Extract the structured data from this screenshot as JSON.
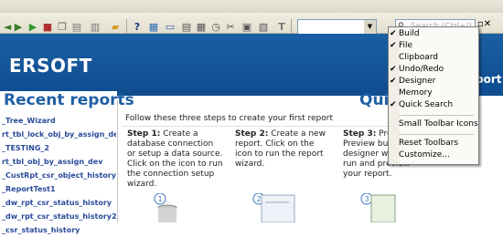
{
  "toolbar": {
    "buttons": [
      "back-icon",
      "forward-icon",
      "run-icon",
      "stop-icon",
      "copy-icon",
      "paste-icon",
      "open-folder-icon",
      "new-folder-icon",
      "help-icon",
      "chart-icon",
      "monitor-icon",
      "table-icon",
      "grid-icon",
      "clock-icon",
      "cut-icon",
      "layout-icon",
      "image-icon",
      "text-icon"
    ],
    "search_placeholder": "Search (Ctrl+I)"
  },
  "header": {
    "brand": "ERSOFT",
    "right_label": "port"
  },
  "left": {
    "title": "Recent reports",
    "items": [
      "_Tree_Wizard",
      "rt_tbl_lock_obj_by_assign_dev",
      "_TESTING_2",
      "rt_tbl_obj_by_assign_dev",
      "_CustRpt_csr_object_history",
      "_ReportTest1",
      "_dw_rpt_csr_status_history",
      "_dw_rpt_csr_status_history2",
      "_csr_status_history"
    ]
  },
  "main": {
    "title": "Quic",
    "intro": "Follow these three steps to create your first report",
    "steps": [
      {
        "label": "Step 1:",
        "text": "Create a database connection or setup a data source. Click on the icon to run the connection setup wizard."
      },
      {
        "label": "Step 2:",
        "text": "Create a new report. Click on the icon to run the report wizard."
      },
      {
        "label": "Step 3:",
        "text": "Pres Preview butt designer win run and preview your report."
      }
    ]
  },
  "menu": {
    "items": [
      {
        "label": "Build",
        "checked": true
      },
      {
        "label": "File",
        "checked": true
      },
      {
        "label": "Clipboard",
        "checked": false
      },
      {
        "label": "Undo/Redo",
        "checked": true
      },
      {
        "label": "Designer",
        "checked": true
      },
      {
        "label": "Memory",
        "checked": false
      },
      {
        "label": "Quick Search",
        "checked": true
      },
      {
        "label": "Small Toolbar Icons",
        "checked": false
      },
      {
        "label": "Reset Toolbars",
        "checked": false
      },
      {
        "label": "Customize...",
        "checked": false
      }
    ],
    "check_glyph": "✔"
  }
}
